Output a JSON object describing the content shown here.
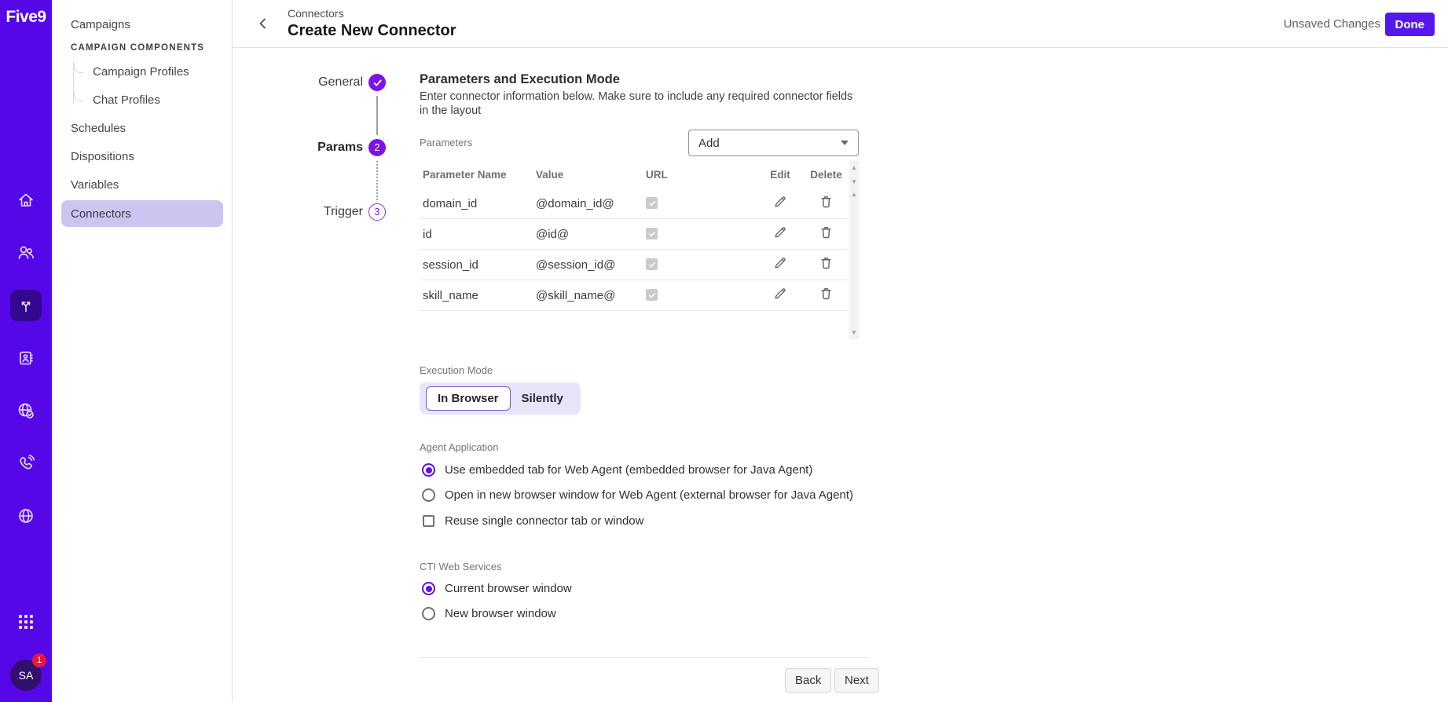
{
  "colors": {
    "rail": "#5507e8",
    "rail_selected": "#31088f",
    "accent": "#7a13ea",
    "done_button": "#5517ee",
    "nav_selected_bg": "#ccc5f0",
    "badge_red": "#e5173f",
    "segment_bg": "#eae4fa"
  },
  "brand": {
    "logo": "Five9"
  },
  "rail": {
    "icons": [
      "home",
      "users",
      "connectors",
      "contacts-book",
      "globe-check",
      "phone",
      "globe"
    ],
    "selected_icon": "connectors",
    "apps_grid": "apps-grid",
    "avatar": {
      "initials": "SA",
      "badge": "1"
    }
  },
  "nav": {
    "items": [
      {
        "label": "Campaigns"
      },
      {
        "label": "CAMPAIGN COMPONENTS"
      },
      {
        "label": "Campaign Profiles"
      },
      {
        "label": "Chat Profiles"
      },
      {
        "label": "Schedules"
      },
      {
        "label": "Dispositions"
      },
      {
        "label": "Variables"
      },
      {
        "label": "Connectors",
        "selected": true
      }
    ]
  },
  "header": {
    "breadcrumb": "Connectors",
    "title": "Create New Connector",
    "status": "Unsaved Changes",
    "done_label": "Done"
  },
  "stepper": {
    "steps": [
      {
        "label": "General",
        "state": "complete"
      },
      {
        "label": "Params",
        "state": "active",
        "badge": "2"
      },
      {
        "label": "Trigger",
        "state": "upcoming",
        "badge": "3"
      }
    ]
  },
  "content": {
    "heading": "Parameters and Execution Mode",
    "subtitle": "Enter connector information below. Make sure to include any required connector fields in the layout",
    "parameters_label": "Parameters",
    "add_dropdown": {
      "value": "Add"
    },
    "table": {
      "headers": [
        "Parameter Name",
        "Value",
        "URL",
        "Edit",
        "Delete"
      ],
      "rows": [
        {
          "name": "domain_id",
          "value": "@domain_id@",
          "url_checked": true
        },
        {
          "name": "id",
          "value": "@id@",
          "url_checked": true
        },
        {
          "name": "session_id",
          "value": "@session_id@",
          "url_checked": true
        },
        {
          "name": "skill_name",
          "value": "@skill_name@",
          "url_checked": true
        }
      ]
    },
    "execution_mode": {
      "label": "Execution Mode",
      "options": [
        "In Browser",
        "Silently"
      ],
      "selected": "In Browser"
    },
    "agent_application": {
      "label": "Agent Application",
      "radios": [
        {
          "label": "Use embedded tab for Web Agent (embedded browser for Java Agent)",
          "selected": true
        },
        {
          "label": "Open in new browser window for Web Agent (external browser for Java Agent)",
          "selected": false
        }
      ],
      "checkbox": {
        "label": "Reuse single connector tab or window",
        "checked": false
      }
    },
    "cti_web_services": {
      "label": "CTI Web Services",
      "radios": [
        {
          "label": "Current browser window",
          "selected": true
        },
        {
          "label": "New browser window",
          "selected": false
        }
      ]
    },
    "footer": {
      "back_label": "Back",
      "next_label": "Next"
    }
  }
}
